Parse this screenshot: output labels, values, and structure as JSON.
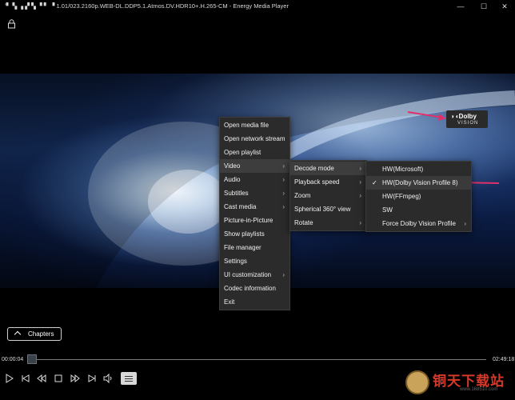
{
  "window": {
    "title": "ʻ▘ ▚ ▗ ▞ ▚ ▝ ▘ ▝ 1.01/023.2160p.WEB-DL.DDP5.1.Atmos.DV.HDR10+.H.265-CM - Energy Media Player",
    "minimize_icon": "—",
    "maximize_icon": "☐",
    "close_icon": "✕"
  },
  "video": {
    "badge_line1": "◗◖Dolby",
    "badge_line2": "VISION"
  },
  "context_menu": {
    "items": [
      {
        "label": "Open media file",
        "submenu": false
      },
      {
        "label": "Open network stream",
        "submenu": false
      },
      {
        "label": "Open playlist",
        "submenu": false
      },
      {
        "label": "Video",
        "submenu": true
      },
      {
        "label": "Audio",
        "submenu": true
      },
      {
        "label": "Subtitles",
        "submenu": true
      },
      {
        "label": "Cast media",
        "submenu": true
      },
      {
        "label": "Picture-in-Picture",
        "submenu": false
      },
      {
        "label": "Show playlists",
        "submenu": false
      },
      {
        "label": "File manager",
        "submenu": false
      },
      {
        "label": "Settings",
        "submenu": false
      },
      {
        "label": "UI customization",
        "submenu": true
      },
      {
        "label": "Codec information",
        "submenu": false
      },
      {
        "label": "Exit",
        "submenu": false
      }
    ],
    "arrow": "›"
  },
  "video_submenu": {
    "items": [
      {
        "label": "Decode mode",
        "submenu": true
      },
      {
        "label": "Playback speed",
        "submenu": true
      },
      {
        "label": "Zoom",
        "submenu": true
      },
      {
        "label": "Spherical 360° view",
        "submenu": false
      },
      {
        "label": "Rotate",
        "submenu": true
      }
    ]
  },
  "decode_submenu": {
    "items": [
      {
        "label": "HW(Microsoft)",
        "checked": false,
        "submenu": false
      },
      {
        "label": "HW(Dolby Vision Profile 8)",
        "checked": true,
        "submenu": false
      },
      {
        "label": "HW(FFmpeg)",
        "checked": false,
        "submenu": false
      },
      {
        "label": "SW",
        "checked": false,
        "submenu": false
      },
      {
        "label": "Force Dolby Vision Profile",
        "checked": false,
        "submenu": true
      }
    ],
    "check_mark": "✓"
  },
  "controls": {
    "chapters_label": "Chapters",
    "current_time": "00:00:04",
    "total_time": "02:49:18",
    "progress": 0.0004
  },
  "watermark": {
    "text": "铜天下载站",
    "url": "www.168510.com"
  },
  "colors": {
    "annotation": "#e0306a",
    "menu_bg": "#2b2b2b"
  }
}
